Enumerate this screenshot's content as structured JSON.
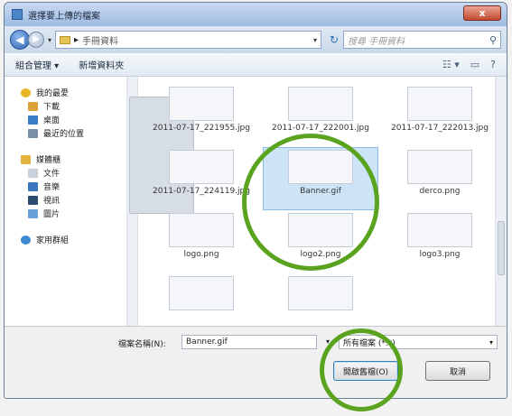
{
  "window": {
    "title": "選擇要上傳的檔案",
    "close_label": "x"
  },
  "address": {
    "path_root": "▸",
    "path_folder": "手冊資料",
    "search_placeholder": "搜尋 手冊資料"
  },
  "toolbar": {
    "organize": "組合管理 ▾",
    "new_folder": "新增資料夾"
  },
  "sidebar": {
    "favorites": [
      {
        "label": "我的最愛",
        "icon": "star-icon",
        "color": "#e8b623"
      },
      {
        "label": "下載",
        "icon": "download-folder-icon",
        "color": "#d9a33a"
      },
      {
        "label": "桌面",
        "icon": "desktop-icon",
        "color": "#3a7dc4"
      },
      {
        "label": "最近的位置",
        "icon": "recent-places-icon",
        "color": "#7a8ea8"
      }
    ],
    "libraries": [
      {
        "label": "媒體櫃",
        "icon": "library-icon",
        "color": "#e3b43c"
      },
      {
        "label": "文件",
        "icon": "documents-icon",
        "color": "#c8d0da"
      },
      {
        "label": "音樂",
        "icon": "music-icon",
        "color": "#3a76c0"
      },
      {
        "label": "視訊",
        "icon": "video-icon",
        "color": "#2c4b70"
      },
      {
        "label": "圖片",
        "icon": "pictures-icon",
        "color": "#6aa0d8"
      }
    ],
    "homegroup": {
      "label": "家用群組",
      "icon": "homegroup-icon",
      "color": "#3f8ad1"
    }
  },
  "files": [
    {
      "name": "2011-07-17_221955.jpg",
      "selected": false
    },
    {
      "name": "2011-07-17_222001.jpg",
      "selected": false
    },
    {
      "name": "2011-07-17_222013.jpg",
      "selected": false
    },
    {
      "name": "2011-07-17_224119.jpg",
      "selected": false
    },
    {
      "name": "Banner.gif",
      "selected": true
    },
    {
      "name": "derco.png",
      "selected": false
    },
    {
      "name": "logo.png",
      "selected": false
    },
    {
      "name": "logo2.png",
      "selected": false
    },
    {
      "name": "logo3.png",
      "selected": false
    },
    {
      "name": "",
      "selected": false
    },
    {
      "name": "",
      "selected": false
    }
  ],
  "footer": {
    "filename_label": "檔案名稱(N):",
    "filename_value": "Banner.gif",
    "type_value": "所有檔案 (*.*)",
    "open_label": "開啟舊檔(O)",
    "cancel_label": "取消"
  },
  "annotation_color": "#5aa31f"
}
